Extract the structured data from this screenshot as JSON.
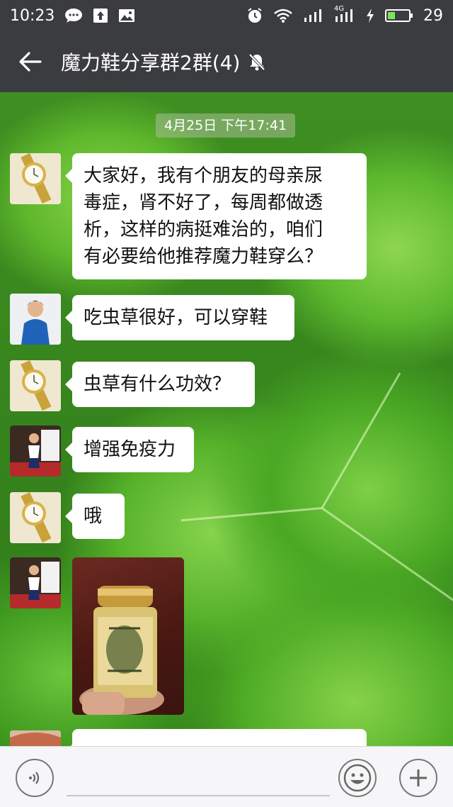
{
  "status_bar": {
    "time": "10:23",
    "left_icons": [
      "chat-bubble-icon",
      "upload-icon",
      "image-icon"
    ],
    "right_icons": [
      "alarm-icon",
      "wifi-icon",
      "signal-icon",
      "4g-signal-icon",
      "charging-icon",
      "battery-icon"
    ],
    "network_label": "4G",
    "battery": "29"
  },
  "title_bar": {
    "back_icon": "back-arrow-icon",
    "title": "魔力鞋分享群2群(4)",
    "mute_icon": "bell-muted-icon"
  },
  "chat": {
    "timestamp": "4月25日 下午17:41",
    "messages": [
      {
        "avatar": "watch-avatar",
        "text_lines": [
          "大家好，我有个朋友的母亲尿",
          "毒症，肾不好了，每周都做透",
          "析，这样的病挺难治的，咱们",
          "有必要给他推荐魔力鞋穿么？"
        ]
      },
      {
        "avatar": "woman-blue-avatar",
        "text": "吃虫草很好，可以穿鞋"
      },
      {
        "avatar": "watch-avatar",
        "text": "虫草有什么功效？"
      },
      {
        "avatar": "woman-red-avatar",
        "text": "增强免疫力"
      },
      {
        "avatar": "watch-avatar",
        "text": "哦"
      },
      {
        "avatar": "woman-red-avatar",
        "image": "cordyceps-capsule-bottle-photo"
      }
    ]
  },
  "input_bar": {
    "voice_icon": "voice-icon",
    "emoji_icon": "emoji-icon",
    "plus_icon": "plus-icon"
  },
  "colors": {
    "bar_bg": "#3b3c40",
    "bubble_bg": "#ffffff",
    "input_bg": "#f6f6f8"
  }
}
